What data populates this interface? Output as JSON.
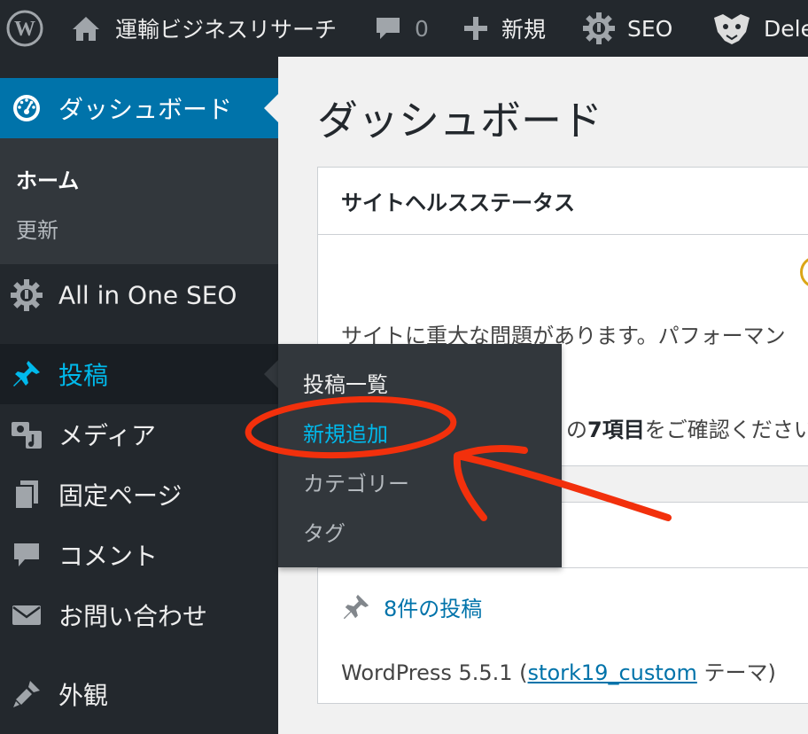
{
  "admin_bar": {
    "site_name": "運輸ビジネスリサーチ",
    "comment_count": "0",
    "new_label": "新規",
    "seo_label": "SEO",
    "user_label": "Dele"
  },
  "sidebar": {
    "dashboard": "ダッシュボード",
    "dashboard_sub": {
      "home": "ホーム",
      "updates": "更新"
    },
    "seo": "All in One SEO",
    "posts": "投稿",
    "media": "メディア",
    "pages": "固定ページ",
    "comments": "コメント",
    "contact": "お問い合わせ",
    "appearance": "外観"
  },
  "posts_flyout": {
    "items": [
      "投稿一覧",
      "新規追加",
      "カテゴリー",
      "タグ"
    ]
  },
  "main": {
    "title": "ダッシュボード",
    "site_health": {
      "heading": "サイトヘルスステータス",
      "message": "サイトに重大な問題があります。パフォーマン",
      "items_prefix": "の",
      "items_bold": "7項目",
      "items_suffix": "をご確認ください"
    },
    "at_a_glance": {
      "posts_count": "8件の投稿",
      "version_prefix": "WordPress 5.5.1 (",
      "theme_link": "stork19_custom",
      "version_suffix": " テーマ)"
    }
  },
  "colors": {
    "admin_bg": "#23282d",
    "active_blue": "#0073aa",
    "highlight_text": "#00b9eb",
    "annotation_red": "#f2300c"
  }
}
